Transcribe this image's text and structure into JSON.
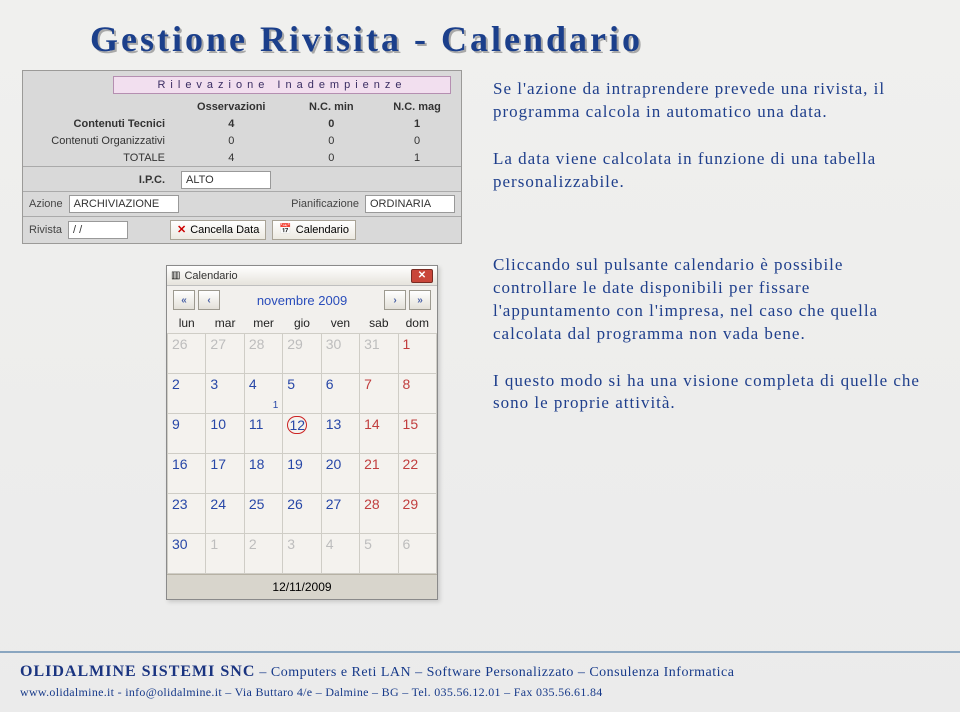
{
  "title": "Gestione Rivisita - Calendario",
  "rilev": {
    "header": "Rilevazione Inadempienze",
    "cols": [
      "Osservazioni",
      "N.C. min",
      "N.C. mag"
    ],
    "rows": [
      {
        "label": "Contenuti Tecnici",
        "bold": true,
        "v": [
          "4",
          "0",
          "1"
        ]
      },
      {
        "label": "Contenuti Organizzativi",
        "bold": false,
        "v": [
          "0",
          "0",
          "0"
        ]
      },
      {
        "label": "TOTALE",
        "bold": false,
        "v": [
          "4",
          "0",
          "1"
        ]
      }
    ],
    "ipc_label": "I.P.C.",
    "ipc_value": "ALTO",
    "azione_label": "Azione",
    "azione_value": "ARCHIVIAZIONE",
    "pianif_label": "Pianificazione",
    "pianif_value": "ORDINARIA",
    "rivista_label": "Rivista",
    "rivista_value": "/  /",
    "cancel_btn": "Cancella Data",
    "cal_btn": "Calendario"
  },
  "calendar": {
    "title": "Calendario",
    "month": "novembre 2009",
    "dow": [
      "lun",
      "mar",
      "mer",
      "gio",
      "ven",
      "sab",
      "dom"
    ],
    "weeks": [
      [
        {
          "n": "26",
          "other": true
        },
        {
          "n": "27",
          "other": true
        },
        {
          "n": "28",
          "other": true
        },
        {
          "n": "29",
          "other": true
        },
        {
          "n": "30",
          "other": true
        },
        {
          "n": "31",
          "other": true
        },
        {
          "n": "1",
          "weekend": true
        }
      ],
      [
        {
          "n": "2"
        },
        {
          "n": "3"
        },
        {
          "n": "4",
          "mark": "1"
        },
        {
          "n": "5"
        },
        {
          "n": "6"
        },
        {
          "n": "7",
          "weekend": true
        },
        {
          "n": "8",
          "weekend": true
        }
      ],
      [
        {
          "n": "9"
        },
        {
          "n": "10"
        },
        {
          "n": "11"
        },
        {
          "n": "12",
          "today": true
        },
        {
          "n": "13"
        },
        {
          "n": "14",
          "weekend": true
        },
        {
          "n": "15",
          "weekend": true
        }
      ],
      [
        {
          "n": "16"
        },
        {
          "n": "17"
        },
        {
          "n": "18"
        },
        {
          "n": "19"
        },
        {
          "n": "20"
        },
        {
          "n": "21",
          "weekend": true
        },
        {
          "n": "22",
          "weekend": true
        }
      ],
      [
        {
          "n": "23"
        },
        {
          "n": "24"
        },
        {
          "n": "25"
        },
        {
          "n": "26"
        },
        {
          "n": "27"
        },
        {
          "n": "28",
          "weekend": true
        },
        {
          "n": "29",
          "weekend": true
        }
      ],
      [
        {
          "n": "30"
        },
        {
          "n": "1",
          "other": true
        },
        {
          "n": "2",
          "other": true
        },
        {
          "n": "3",
          "other": true
        },
        {
          "n": "4",
          "other": true
        },
        {
          "n": "5",
          "other": true
        },
        {
          "n": "6",
          "other": true
        }
      ]
    ],
    "footer": "12/11/2009"
  },
  "body": {
    "p1": "Se l'azione da intraprendere prevede una rivista, il programma calcola in automatico una data.",
    "p2": "La data viene calcolata in funzione di una tabella personalizzabile.",
    "p3": "Cliccando sul pulsante calendario è possibile controllare le date disponibili per fissare l'appuntamento con l'impresa, nel caso che quella calcolata dal programma non vada bene.",
    "p4": "I questo modo si ha una visione completa di quelle che sono le proprie attività."
  },
  "footer": {
    "brand": "OLIDALMINE SISTEMI SNC",
    "line1_rest": " – Computers e Reti LAN – Software Personalizzato – Consulenza Informatica",
    "line2": "www.olidalmine.it - info@olidalmine.it – Via Buttaro 4/e – Dalmine – BG – Tel. 035.56.12.01 – Fax 035.56.61.84"
  }
}
